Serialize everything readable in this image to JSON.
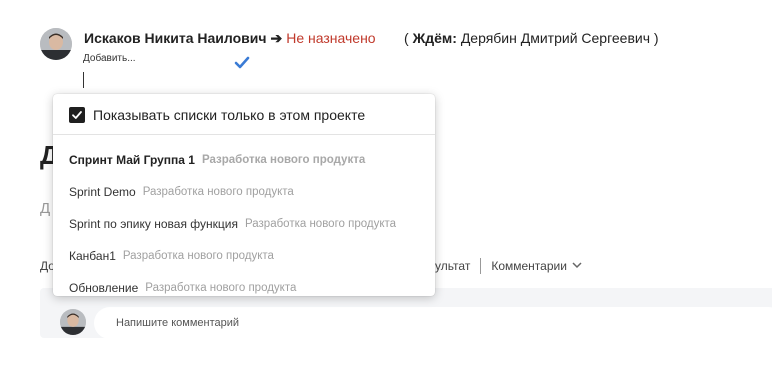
{
  "task_header": {
    "assignee": "Искаков Никита Наилович",
    "arrow": "➔",
    "status": "Не назначено",
    "waiting_open": "(",
    "waiting_label": "Ждём:",
    "waiting_person": "Дерябин Дмитрий Сергеевич )",
    "add_label": "Добавить..."
  },
  "background": {
    "title_fragment": "Д",
    "subtitle_fragment": "Д",
    "tabs_left_fragment": "До",
    "tab_result_fragment": "ультат",
    "tab_comments": "Комментарии"
  },
  "comment": {
    "placeholder": "Напишите комментарий"
  },
  "dropdown": {
    "filter_label": "Показывать списки только в этом проекте",
    "filter_checked": true,
    "items": [
      {
        "name": "Спринт Май Группа 1",
        "project": "Разработка нового продукта",
        "selected": true
      },
      {
        "name": "Sprint Demo",
        "project": "Разработка нового продукта",
        "selected": false
      },
      {
        "name": "Sprint по эпику новая функция",
        "project": "Разработка нового продукта",
        "selected": false
      },
      {
        "name": "Канбан1",
        "project": "Разработка нового продукта",
        "selected": false
      },
      {
        "name": "Обновление",
        "project": "Разработка нового продукта",
        "selected": false
      }
    ]
  },
  "icons": {
    "check": "check-icon",
    "chevron": "chevron-down-icon",
    "checkbox": "checkbox-checked-icon"
  },
  "colors": {
    "status_red": "#c0392b",
    "check_blue": "#3a7bd5",
    "muted_text": "#a0a0a0"
  }
}
